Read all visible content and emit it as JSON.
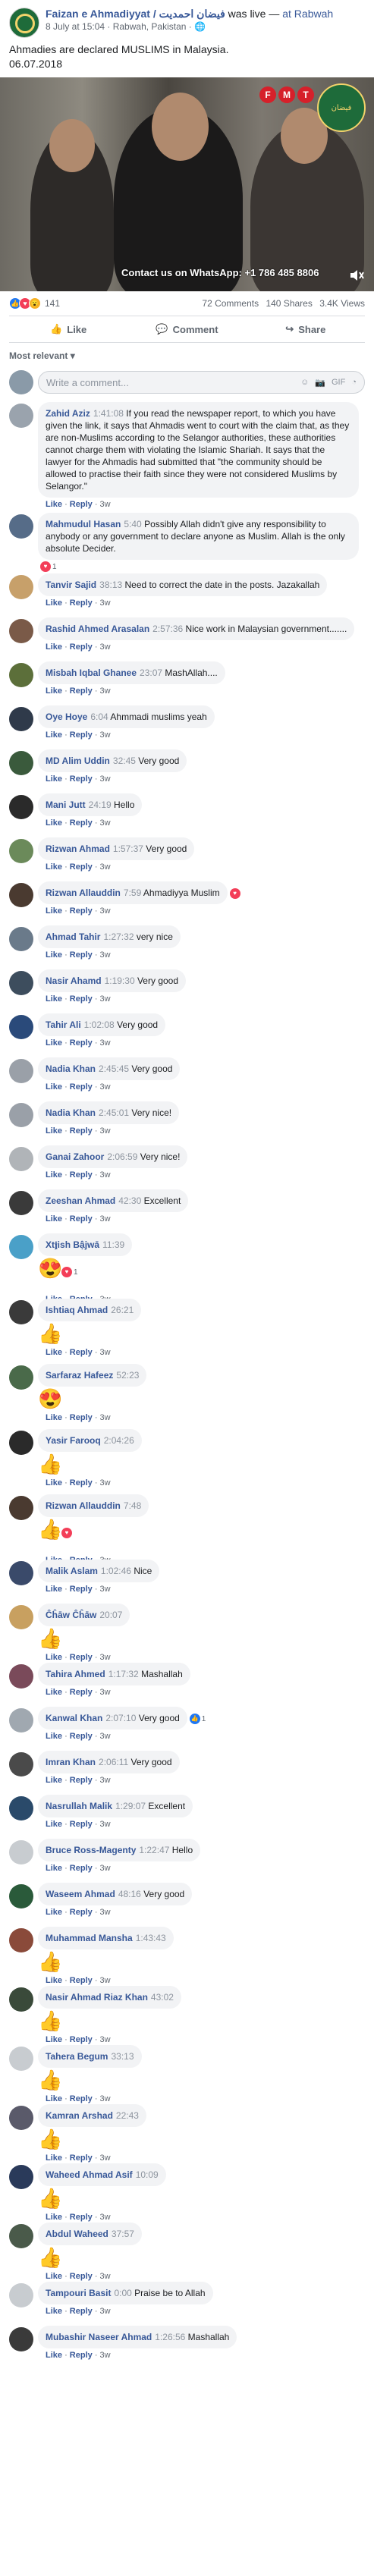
{
  "post": {
    "author": "Faizan e Ahmadiyyat / فیضان احمدیت",
    "live_text": "was live —",
    "location": "at Rabwah",
    "meta": "8 July at 15:04 · Rabwah, Pakistan · ",
    "text_line1": "Ahmadies are declared MUSLIMS in Malaysia.",
    "text_line2": "06.07.2018"
  },
  "video": {
    "fmt_letters": [
      "F",
      "M",
      "T"
    ],
    "caption": "Contact us on WhatsApp: +1 786 485 8806"
  },
  "stats": {
    "reaction_count": "141",
    "comments": "72 Comments",
    "shares": "140 Shares",
    "views": "3.4K Views"
  },
  "actions": {
    "like": "Like",
    "comment": "Comment",
    "share": "Share"
  },
  "sort_label": "Most relevant ▾",
  "comment_placeholder": "Write a comment...",
  "comment_actions": {
    "like": "Like",
    "reply": "Reply",
    "age": "3w"
  },
  "comments": [
    {
      "name": "Zahid Aziz",
      "time": "1:41:08",
      "text": "If you read the newspaper report, to which you have given the link, it says that Ahmadis went to court with the claim that, as they are non-Muslims according to the Selangor authorities, these authorities cannot charge them with violating the Islamic Shariah. It says that the lawyer for the Ahmadis had submitted that \"the community should be allowed to practise their faith since they were not considered Muslims by Selangor.\"",
      "color": "#9aa3ad"
    },
    {
      "name": "Mahmudul Hasan",
      "time": "5:40",
      "text": "Possibly Allah didn't give any responsibility to anybody or any government to declare anyone as Muslim. Allah is the only absolute Decider.",
      "color": "#566c88",
      "reaction": "heart",
      "react_count": "1"
    },
    {
      "name": "Tanvir Sajid",
      "time": "38:13",
      "text": "Need to correct the date in the posts. Jazakallah",
      "color": "#c7a06a"
    },
    {
      "name": "Rashid Ahmed Arasalan",
      "time": "2:57:36",
      "text": "Nice work in Malaysian government.......",
      "color": "#7a5a48"
    },
    {
      "name": "Misbah Iqbal Ghanee",
      "time": "23:07",
      "text": "MashAllah....",
      "color": "#5c6f3a"
    },
    {
      "name": "Oye Hoye",
      "time": "6:04",
      "text": "Ahmmadi muslims yeah",
      "color": "#2f3a4a"
    },
    {
      "name": "MD Alim Uddin",
      "time": "32:45",
      "text": "Very good",
      "color": "#3a5a3c"
    },
    {
      "name": "Mani Jutt",
      "time": "24:19",
      "text": "Hello",
      "color": "#2a2a2a"
    },
    {
      "name": "Rizwan Ahmad",
      "time": "1:57:37",
      "text": "Very good",
      "color": "#6b8a5a"
    },
    {
      "name": "Rizwan Allauddin",
      "time": "7:59",
      "text": "Ahmadiyya Muslim",
      "color": "#4a3a30",
      "reaction": "heart",
      "react_count": ""
    },
    {
      "name": "Ahmad Tahir",
      "time": "1:27:32",
      "text": "very nice",
      "color": "#6a7a8a"
    },
    {
      "name": "Nasir Ahamd",
      "time": "1:19:30",
      "text": "Very good",
      "color": "#3d4d5d"
    },
    {
      "name": "Tahir Ali",
      "time": "1:02:08",
      "text": "Very good",
      "color": "#2a4a7a"
    },
    {
      "name": "Nadia Khan",
      "time": "2:45:45",
      "text": "Very good",
      "color": "#9aa0a8"
    },
    {
      "name": "Nadia Khan",
      "time": "2:45:01",
      "text": "Very nice!",
      "color": "#9aa0a8"
    },
    {
      "name": "Ganai Zahoor",
      "time": "2:06:59",
      "text": "Very nice!",
      "color": "#b0b4b8"
    },
    {
      "name": "Zeeshan Ahmad",
      "time": "42:30",
      "text": "Excellent",
      "color": "#3a3a3a"
    },
    {
      "name": "Xt𝖏ish Bậjwā",
      "time": "11:39",
      "text": "",
      "emoji": "😍",
      "color": "#4aa0c8",
      "reaction": "heart",
      "react_count": "1"
    },
    {
      "name": "Ishtiaq Ahmad",
      "time": "26:21",
      "text": "",
      "emoji": "👍",
      "color": "#3a3a3a"
    },
    {
      "name": "Sarfaraz Hafeez",
      "time": "52:23",
      "text": "",
      "emoji": "😍",
      "color": "#4a6a4a"
    },
    {
      "name": "Yasir Farooq",
      "time": "2:04:26",
      "text": "",
      "emoji": "👍",
      "color": "#2a2a2a"
    },
    {
      "name": "Rizwan Allauddin",
      "time": "7:48",
      "text": "",
      "emoji": "👍",
      "color": "#4a3a30",
      "reaction": "heart",
      "react_count": ""
    },
    {
      "name": "Malik Aslam",
      "time": "1:02:46",
      "text": "Nice",
      "color": "#3a4a6a"
    },
    {
      "name": "Ĉĥāw Ĉĥāw",
      "time": "20:07",
      "text": "",
      "emoji": "👍",
      "color": "#c8a060"
    },
    {
      "name": "Tahira Ahmed",
      "time": "1:17:32",
      "text": "Mashallah",
      "color": "#7a4a5a"
    },
    {
      "name": "Kanwal Khan",
      "time": "2:07:10",
      "text": "Very good",
      "color": "#a0a8b0",
      "reaction": "like",
      "react_count": "1"
    },
    {
      "name": "Imran Khan",
      "time": "2:06:11",
      "text": "Very good",
      "color": "#4a4a4a"
    },
    {
      "name": "Nasrullah Malik",
      "time": "1:29:07",
      "text": "Excellent",
      "color": "#2a4a6a"
    },
    {
      "name": "Bruce Ross-Magenty",
      "time": "1:22:47",
      "text": "Hello",
      "color": "#c8ccd0"
    },
    {
      "name": "Waseem Ahmad",
      "time": "48:16",
      "text": "Very good",
      "color": "#2a5a3a"
    },
    {
      "name": "Muhammad Mansha",
      "time": "1:43:43",
      "text": "",
      "emoji": "👍",
      "color": "#8a4a3a"
    },
    {
      "name": "Nasir Ahmad Riaz Khan",
      "time": "43:02",
      "text": "",
      "emoji": "👍",
      "color": "#3a4a3a"
    },
    {
      "name": "Tahera Begum",
      "time": "33:13",
      "text": "",
      "emoji": "👍",
      "color": "#c8ccd0"
    },
    {
      "name": "Kamran Arshad",
      "time": "22:43",
      "text": "",
      "emoji": "👍",
      "color": "#5a5a6a"
    },
    {
      "name": "Waheed Ahmad Asif",
      "time": "10:09",
      "text": "",
      "emoji": "👍",
      "color": "#2a3a5a"
    },
    {
      "name": "Abdul Waheed",
      "time": "37:57",
      "text": "",
      "emoji": "👍",
      "color": "#4a5a4a"
    },
    {
      "name": "Tampouri Basit",
      "time": "0:00",
      "text": "Praise be to Allah",
      "color": "#c8ccd0"
    },
    {
      "name": "Mubashir Naseer Ahmad",
      "time": "1:26:56",
      "text": "Mashallah",
      "color": "#3a3a3a"
    }
  ]
}
